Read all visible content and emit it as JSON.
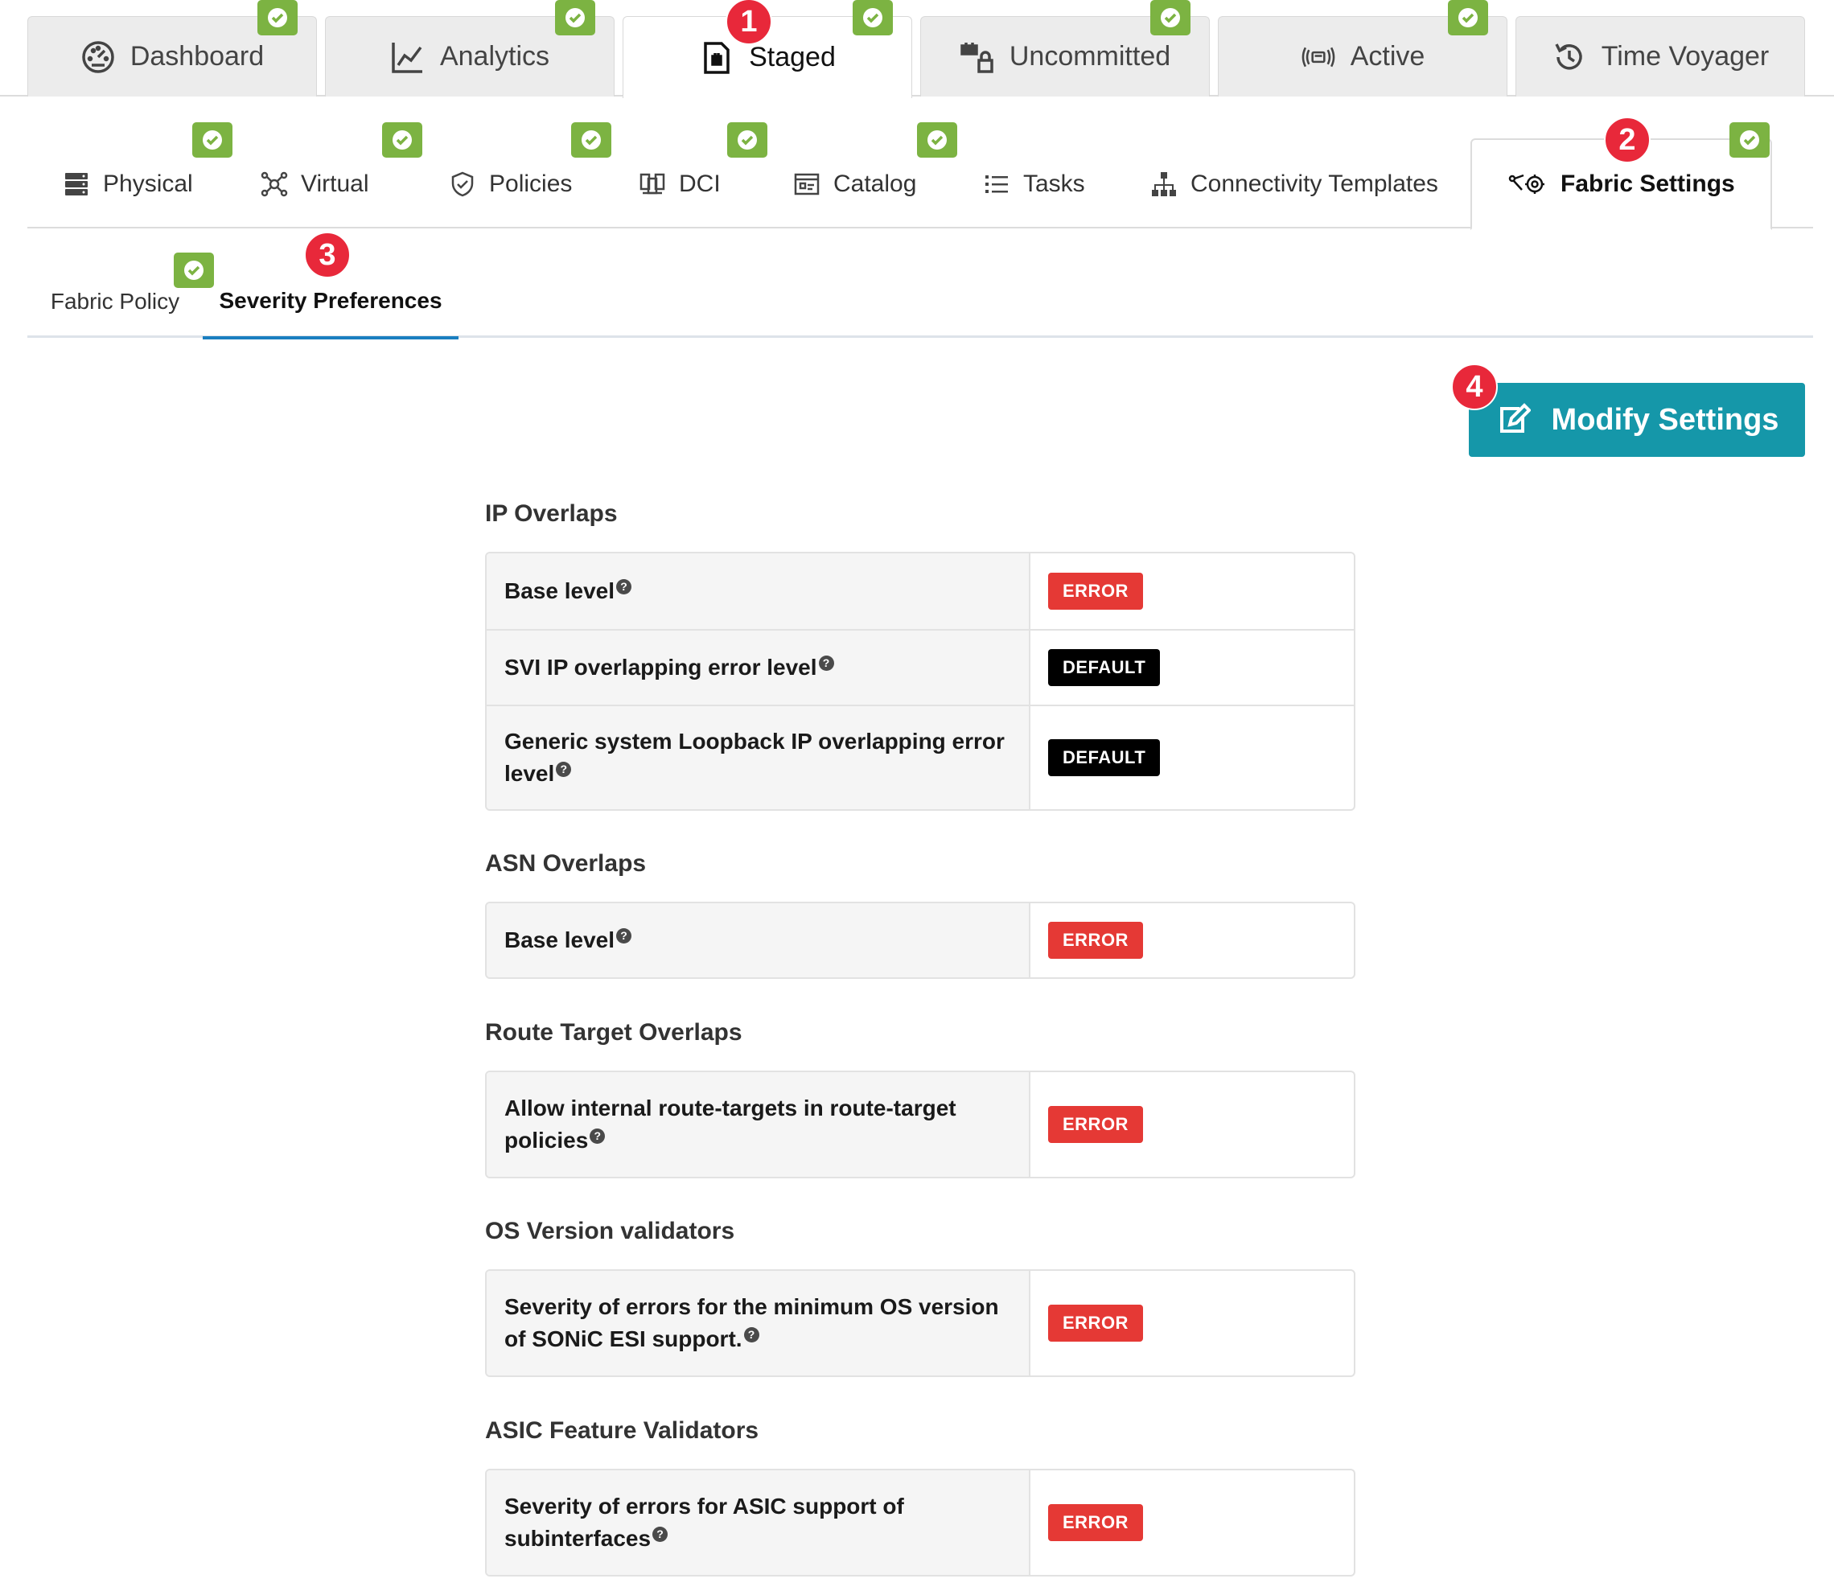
{
  "top_tabs": [
    {
      "label": "Dashboard",
      "icon": "gauge-icon"
    },
    {
      "label": "Analytics",
      "icon": "line-chart-icon"
    },
    {
      "label": "Staged",
      "icon": "staged-file-icon",
      "active": true
    },
    {
      "label": "Uncommitted",
      "icon": "uncommitted-icon"
    },
    {
      "label": "Active",
      "icon": "broadcast-icon"
    },
    {
      "label": "Time Voyager",
      "icon": "history-icon"
    }
  ],
  "sub_tabs": [
    {
      "label": "Physical",
      "icon": "server-stack-icon"
    },
    {
      "label": "Virtual",
      "icon": "network-nodes-icon"
    },
    {
      "label": "Policies",
      "icon": "shield-check-icon"
    },
    {
      "label": "DCI",
      "icon": "dci-icon"
    },
    {
      "label": "Catalog",
      "icon": "catalog-icon"
    },
    {
      "label": "Tasks",
      "icon": "list-icon"
    },
    {
      "label": "Connectivity Templates",
      "icon": "hierarchy-icon"
    },
    {
      "label": "Fabric Settings",
      "icon": "fabric-gear-icon",
      "active": true
    }
  ],
  "third_tabs": [
    {
      "label": "Fabric Policy"
    },
    {
      "label": "Severity Preferences",
      "active": true
    }
  ],
  "step_badges": [
    "1",
    "2",
    "3",
    "4"
  ],
  "modify_button": {
    "label": "Modify Settings",
    "icon": "edit-icon"
  },
  "sections": [
    {
      "title": "IP Overlaps",
      "rows": [
        {
          "label": "Base level",
          "value": "ERROR"
        },
        {
          "label": "SVI IP overlapping error level",
          "value": "DEFAULT"
        },
        {
          "label": "Generic system Loopback IP overlapping error level",
          "value": "DEFAULT"
        }
      ]
    },
    {
      "title": "ASN Overlaps",
      "rows": [
        {
          "label": "Base level",
          "value": "ERROR"
        }
      ]
    },
    {
      "title": "Route Target Overlaps",
      "rows": [
        {
          "label": "Allow internal route-targets in route-target policies",
          "value": "ERROR"
        }
      ]
    },
    {
      "title": "OS Version validators",
      "rows": [
        {
          "label": "Severity of errors for the minimum OS version of SONiC ESI support.",
          "value": "ERROR"
        }
      ]
    },
    {
      "title": "ASIC Feature Validators",
      "rows": [
        {
          "label": "Severity of errors for ASIC support of subinterfaces",
          "value": "ERROR"
        }
      ]
    }
  ],
  "help_glyph": "?",
  "colors": {
    "check_green": "#7cb342",
    "step_red": "#e8283a",
    "button_teal": "#1597a9",
    "error_red": "#e53935",
    "default_black": "#000000",
    "active_underline": "#1a7fc0"
  }
}
